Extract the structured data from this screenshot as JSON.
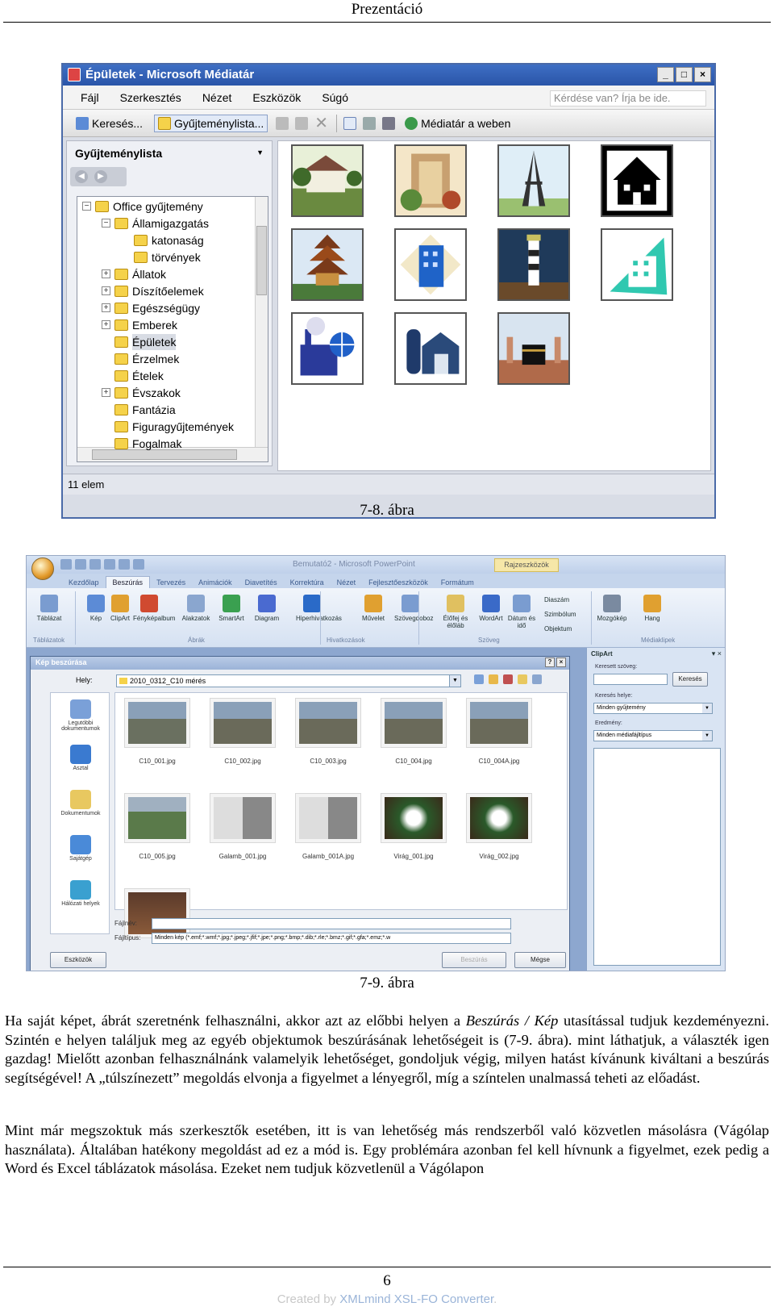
{
  "header": {
    "title": "Prezentáció"
  },
  "figure1": {
    "window_title": "Épületek - Microsoft Médiatár",
    "window_controls": [
      "_",
      "□",
      "×"
    ],
    "menus": [
      "Fájl",
      "Szerkesztés",
      "Nézet",
      "Eszközök",
      "Súgó"
    ],
    "help_box": "Kérdése van? Írja be ide.",
    "toolbar": {
      "search": "Keresés...",
      "collection_list": "Gyűjteménylista...",
      "web_gallery": "Médiatár a weben"
    },
    "pane_title": "Gyűjteménylista",
    "tree": [
      {
        "label": "Office gyűjtemény",
        "level": 0,
        "expander": "−"
      },
      {
        "label": "Államigazgatás",
        "level": 1,
        "expander": "−"
      },
      {
        "label": "katonaság",
        "level": 2,
        "expander": ""
      },
      {
        "label": "törvények",
        "level": 2,
        "expander": ""
      },
      {
        "label": "Állatok",
        "level": 1,
        "expander": "+"
      },
      {
        "label": "Díszítőelemek",
        "level": 1,
        "expander": "+"
      },
      {
        "label": "Egészségügy",
        "level": 1,
        "expander": "+"
      },
      {
        "label": "Emberek",
        "level": 1,
        "expander": "+"
      },
      {
        "label": "Épületek",
        "level": 1,
        "expander": "",
        "selected": true
      },
      {
        "label": "Érzelmek",
        "level": 1,
        "expander": ""
      },
      {
        "label": "Ételek",
        "level": 1,
        "expander": ""
      },
      {
        "label": "Évszakok",
        "level": 1,
        "expander": "+"
      },
      {
        "label": "Fantázia",
        "level": 1,
        "expander": ""
      },
      {
        "label": "Figuragyűjtemények",
        "level": 1,
        "expander": ""
      },
      {
        "label": "Fogalmak",
        "level": 1,
        "expander": ""
      }
    ],
    "clips": [
      "house-clipart",
      "colorful-building-clipart",
      "eiffel-tower-clipart",
      "house-silhouette-clipart",
      "pagoda-clipart",
      "blue-office-building-clipart",
      "lighthouse-clipart",
      "teal-building-clipart",
      "factory-globe-clipart",
      "barn-silo-clipart",
      "kaaba-clipart"
    ],
    "status": "11 elem",
    "caption": "7-8. ábra"
  },
  "figure2": {
    "app_title": "Bemutató2 - Microsoft PowerPoint",
    "contextual_tab": "Rajzeszközök",
    "tabs": [
      "Kezdőlap",
      "Beszúrás",
      "Tervezés",
      "Animációk",
      "Diavetítés",
      "Korrektúra",
      "Nézet",
      "Fejlesztőeszközök",
      "Formátum"
    ],
    "ribbon_items": [
      "Táblázat",
      "Kép",
      "ClipArt",
      "Fényképalbum",
      "Alakzatok",
      "SmartArt",
      "Diagram",
      "Hiperhivatkozás",
      "Művelet",
      "Szövegdoboz",
      "Élőfej és élőláb",
      "WordArt",
      "Dátum és idő",
      "Mozgókép",
      "Hang"
    ],
    "ribbon_small": [
      "Diaszám",
      "Szimbólum",
      "Objektum"
    ],
    "ribbon_groups": [
      "Táblázatok",
      "Ábrák",
      "Hivatkozások",
      "Szöveg",
      "Médiaklipek"
    ],
    "dialog": {
      "title": "Kép beszúrása",
      "controls": [
        "?",
        "×"
      ],
      "location_label": "Hely:",
      "location": "2010_0312_C10 mérés",
      "places": [
        "Legutóbbi dokumentumok",
        "Asztal",
        "Dokumentumok",
        "Sajátgép",
        "Hálózati helyek"
      ],
      "files": [
        "C10_001.jpg",
        "C10_002.jpg",
        "C10_003.jpg",
        "C10_004.jpg",
        "C10_004A.jpg",
        "C10_005.jpg",
        "Galamb_001.jpg",
        "Galamb_001A.jpg",
        "Virág_001.jpg",
        "Virág_002.jpg",
        ""
      ],
      "filename_label": "Fájlnév:",
      "filetype_label": "Fájltípus:",
      "filetype": "Minden kép (*.emf;*.wmf;*.jpg;*.jpeg;*.jfif;*.jpe;*.png;*.bmp;*.dib;*.rle;*.bmz;*.gif;*.gfa;*.emz;*.w",
      "tools_button": "Eszközök",
      "insert_button": "Beszúrás",
      "cancel_button": "Mégse"
    },
    "clipart_pane": {
      "title": "ClipArt",
      "search_label": "Keresett szöveg:",
      "search_button": "Keresés",
      "search_in_label": "Keresés helye:",
      "search_in": "Minden gyűjtemény",
      "results_label": "Eredmény:",
      "results": "Minden médiafájltípus"
    },
    "caption": "7-9. ábra"
  },
  "paragraphs": [
    {
      "before": "Ha saját képet, ábrát szeretnénk felhasználni, akkor azt az előbbi helyen a ",
      "italic": "Beszúrás / Kép",
      "after": " utasítással tudjuk kezdeményezni. Szintén e helyen találjuk meg az egyéb objektumok beszúrásának lehetőségeit is (7-9. ábra). mint láthatjuk, a választék igen gazdag! Mielőtt azonban felhasználnánk valamelyik lehetőséget, gondoljuk végig, milyen hatást kívánunk kiváltani a beszúrás segítségével! A „túlszínezett” megoldás elvonja a figyelmet a lényegről, míg a színtelen unalmassá teheti az előadást."
    },
    {
      "text": "Mint már megszoktuk más szerkesztők esetében, itt is van lehetőség más rendszerből való közvetlen másolásra (Vágólap használata). Általában hatékony megoldást ad ez a mód is. Egy problémára azonban fel kell hívnunk a figyelmet, ezek pedig a Word és Excel táblázatok másolása. Ezeket nem tudjuk közvetlenül a Vágólapon"
    }
  ],
  "footer": {
    "page_number": "6",
    "watermark_prefix": "Created by ",
    "watermark_brand": "XMLmind XSL-FO Converter",
    "watermark_suffix": "."
  }
}
